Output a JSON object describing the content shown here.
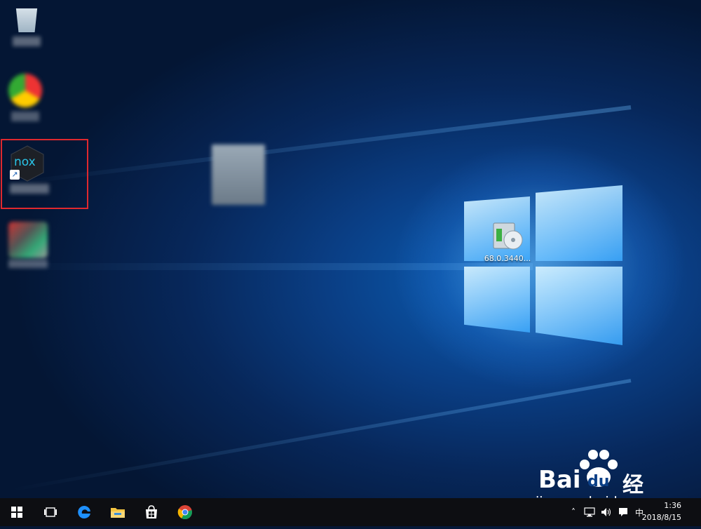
{
  "desktop": {
    "icons": [
      {
        "name": "recycle-bin",
        "label": ""
      },
      {
        "name": "chrome-like-app",
        "label": ""
      },
      {
        "name": "nox-player",
        "logo_text": "nox",
        "label": ""
      },
      {
        "name": "blurred-app",
        "label": ""
      },
      {
        "name": "installer-file",
        "label": "68.0.3440..."
      }
    ],
    "selection_color": "#e0282e"
  },
  "taskbar": {
    "buttons": [
      "start-icon",
      "task-view-icon",
      "edge-icon",
      "file-explorer-icon",
      "store-icon",
      "chrome-icon"
    ],
    "tray": {
      "ime": "中",
      "time": "1:36",
      "date": "2018/8/15"
    }
  },
  "watermark": {
    "brand_latin_1": "Bai",
    "brand_latin_2": "du",
    "brand_cn": "经验",
    "url": "jingyan.baidu.com"
  }
}
